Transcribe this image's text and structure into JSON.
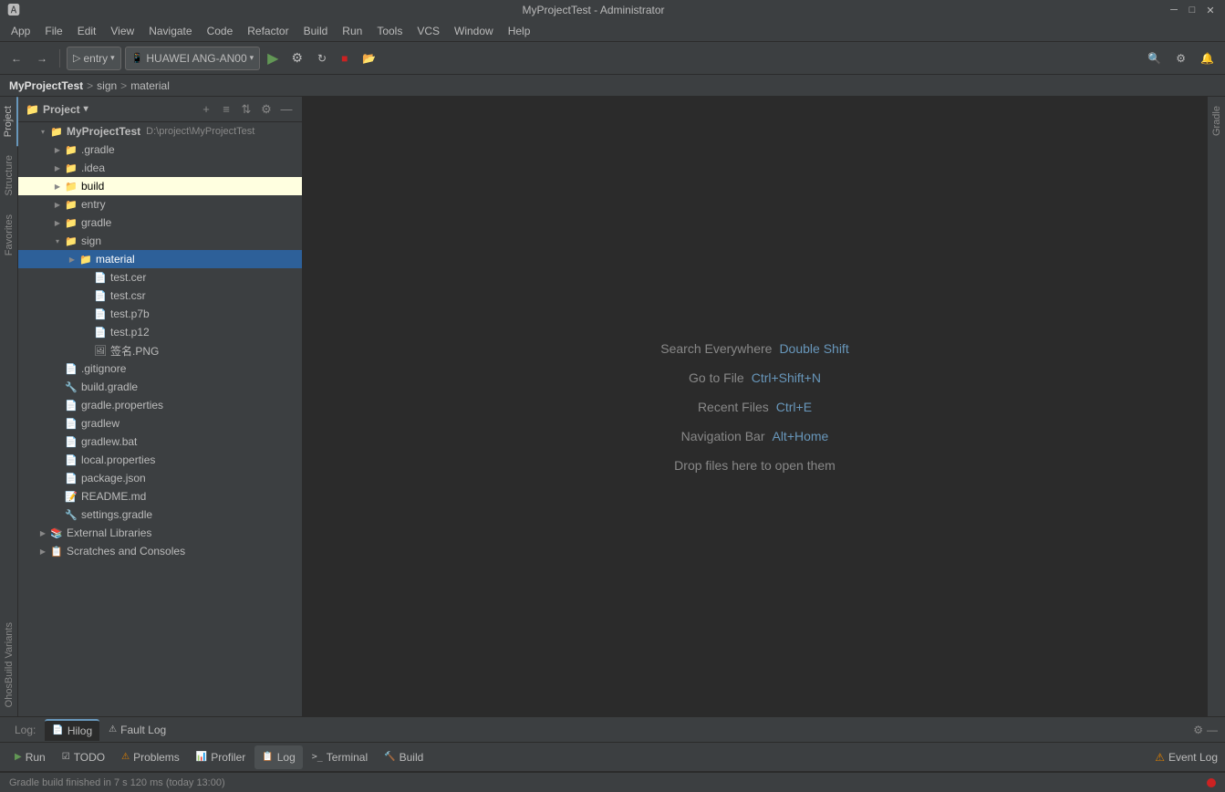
{
  "titleBar": {
    "title": "MyProjectTest - Administrator",
    "minimize": "─",
    "maximize": "□",
    "close": "✕"
  },
  "menuBar": {
    "items": [
      "App",
      "File",
      "Edit",
      "View",
      "Navigate",
      "Code",
      "Refactor",
      "Build",
      "Run",
      "Tools",
      "VCS",
      "Window",
      "Help"
    ]
  },
  "toolbar": {
    "backBtn": "←",
    "forwardBtn": "→",
    "entryDropdown": "entry",
    "deviceDropdown": "HUAWEI ANG-AN00",
    "runBtn": "▶",
    "buildVariantsBtn": "⚙",
    "syncBtn": "↻",
    "stopBtn": "■",
    "profileBtn": "📂",
    "searchBtn": "🔍",
    "settingsBtn": "⚙",
    "notifBtn": "🔔"
  },
  "breadcrumb": {
    "project": "MyProjectTest",
    "sep1": ">",
    "sign": "sign",
    "sep2": ">",
    "material": "material"
  },
  "projectPanel": {
    "title": "Project",
    "dropdownArrow": "▾",
    "icons": [
      "+",
      "≡",
      "⇅",
      "⚙",
      "—"
    ]
  },
  "fileTree": {
    "items": [
      {
        "id": "root",
        "level": 0,
        "expanded": true,
        "arrow": "▾",
        "icon": "📁",
        "iconClass": "icon-folder-open",
        "name": "MyProjectTest",
        "path": "D:/project/MyProjectTest",
        "type": "project"
      },
      {
        "id": "gradle",
        "level": 1,
        "expanded": false,
        "arrow": "▶",
        "icon": "📁",
        "iconClass": "icon-folder",
        "name": ".gradle",
        "path": "",
        "type": "folder"
      },
      {
        "id": "idea",
        "level": 1,
        "expanded": false,
        "arrow": "▶",
        "icon": "📁",
        "iconClass": "icon-folder",
        "name": ".idea",
        "path": "",
        "type": "folder"
      },
      {
        "id": "build",
        "level": 1,
        "expanded": false,
        "arrow": "▶",
        "icon": "📁",
        "iconClass": "icon-folder",
        "name": "build",
        "path": "",
        "type": "folder",
        "highlighted": true
      },
      {
        "id": "entry",
        "level": 1,
        "expanded": false,
        "arrow": "▶",
        "icon": "📁",
        "iconClass": "icon-folder",
        "name": "entry",
        "path": "",
        "type": "folder"
      },
      {
        "id": "gradle2",
        "level": 1,
        "expanded": false,
        "arrow": "▶",
        "icon": "📁",
        "iconClass": "icon-folder",
        "name": "gradle",
        "path": "",
        "type": "folder"
      },
      {
        "id": "sign",
        "level": 1,
        "expanded": true,
        "arrow": "▾",
        "icon": "📁",
        "iconClass": "icon-folder-open",
        "name": "sign",
        "path": "",
        "type": "folder"
      },
      {
        "id": "material",
        "level": 2,
        "expanded": true,
        "arrow": "▶",
        "icon": "📁",
        "iconClass": "icon-folder-open",
        "name": "material",
        "path": "",
        "type": "folder",
        "selected": true
      },
      {
        "id": "testcer",
        "level": 3,
        "expanded": false,
        "arrow": "",
        "icon": "📄",
        "iconClass": "icon-cert",
        "name": "test.cer",
        "path": "",
        "type": "file"
      },
      {
        "id": "testcsr",
        "level": 3,
        "expanded": false,
        "arrow": "",
        "icon": "📄",
        "iconClass": "icon-cert",
        "name": "test.csr",
        "path": "",
        "type": "file"
      },
      {
        "id": "testp7b",
        "level": 3,
        "expanded": false,
        "arrow": "",
        "icon": "📄",
        "iconClass": "icon-cert",
        "name": "test.p7b",
        "path": "",
        "type": "file"
      },
      {
        "id": "testp12",
        "level": 3,
        "expanded": false,
        "arrow": "",
        "icon": "📄",
        "iconClass": "icon-cert",
        "name": "test.p12",
        "path": "",
        "type": "file"
      },
      {
        "id": "sign_png",
        "level": 3,
        "expanded": false,
        "arrow": "",
        "icon": "🖼",
        "iconClass": "icon-file",
        "name": "签名.PNG",
        "path": "",
        "type": "file"
      },
      {
        "id": "gitignore",
        "level": 1,
        "expanded": false,
        "arrow": "",
        "icon": "📄",
        "iconClass": "icon-file",
        "name": ".gitignore",
        "path": "",
        "type": "file"
      },
      {
        "id": "buildgradle",
        "level": 1,
        "expanded": false,
        "arrow": "",
        "icon": "🔧",
        "iconClass": "icon-gradle",
        "name": "build.gradle",
        "path": "",
        "type": "file"
      },
      {
        "id": "gradleprops",
        "level": 1,
        "expanded": false,
        "arrow": "",
        "icon": "📄",
        "iconClass": "icon-properties",
        "name": "gradle.properties",
        "path": "",
        "type": "file"
      },
      {
        "id": "gradlew",
        "level": 1,
        "expanded": false,
        "arrow": "",
        "icon": "📄",
        "iconClass": "icon-file",
        "name": "gradlew",
        "path": "",
        "type": "file"
      },
      {
        "id": "gradlewbat",
        "level": 1,
        "expanded": false,
        "arrow": "",
        "icon": "📄",
        "iconClass": "icon-file",
        "name": "gradlew.bat",
        "path": "",
        "type": "file"
      },
      {
        "id": "localprops",
        "level": 1,
        "expanded": false,
        "arrow": "",
        "icon": "📄",
        "iconClass": "icon-properties",
        "name": "local.properties",
        "path": "",
        "type": "file"
      },
      {
        "id": "packagejson",
        "level": 1,
        "expanded": false,
        "arrow": "",
        "icon": "📄",
        "iconClass": "icon-file",
        "name": "package.json",
        "path": "",
        "type": "file"
      },
      {
        "id": "readme",
        "level": 1,
        "expanded": false,
        "arrow": "",
        "icon": "📝",
        "iconClass": "icon-file",
        "name": "README.md",
        "path": "",
        "type": "file"
      },
      {
        "id": "settingsgradle",
        "level": 1,
        "expanded": false,
        "arrow": "",
        "icon": "🔧",
        "iconClass": "icon-gradle",
        "name": "settings.gradle",
        "path": "",
        "type": "file"
      },
      {
        "id": "external",
        "level": 0,
        "expanded": false,
        "arrow": "▶",
        "icon": "📚",
        "iconClass": "icon-external-lib",
        "name": "External Libraries",
        "path": "",
        "type": "external"
      },
      {
        "id": "scratches",
        "level": 0,
        "expanded": false,
        "arrow": "▶",
        "icon": "📋",
        "iconClass": "icon-scratch",
        "name": "Scratches and Consoles",
        "path": "",
        "type": "scratches"
      }
    ]
  },
  "editorArea": {
    "hints": [
      {
        "label": "Search Everywhere",
        "shortcut": "Double Shift"
      },
      {
        "label": "Go to File",
        "shortcut": "Ctrl+Shift+N"
      },
      {
        "label": "Recent Files",
        "shortcut": "Ctrl+E"
      },
      {
        "label": "Navigation Bar",
        "shortcut": "Alt+Home"
      },
      {
        "label": "Drop files here to open them",
        "shortcut": ""
      }
    ]
  },
  "leftSidePanels": {
    "project": "Project",
    "structure": "Structure",
    "favorites": "Favorites",
    "buildVariants": "OhosBuild Variants"
  },
  "rightSidePanels": {
    "gradle": "Gradle"
  },
  "logTabs": {
    "label": "Log:",
    "tabs": [
      {
        "name": "Hilog",
        "active": true
      },
      {
        "name": "Fault Log",
        "active": false
      }
    ]
  },
  "bottomTabs": {
    "tabs": [
      {
        "name": "Run",
        "icon": "▶",
        "active": false
      },
      {
        "name": "TODO",
        "icon": "☑",
        "active": false
      },
      {
        "name": "Problems",
        "icon": "⚠",
        "active": false
      },
      {
        "name": "Profiler",
        "icon": "📊",
        "active": false
      },
      {
        "name": "Log",
        "icon": "📋",
        "active": true
      },
      {
        "name": "Terminal",
        "icon": ">_",
        "active": false
      },
      {
        "name": "Build",
        "icon": "🔨",
        "active": false
      }
    ],
    "eventLog": "Event Log"
  },
  "statusBar": {
    "text": "Gradle build finished in 7 s 120 ms (today 13:00)"
  }
}
